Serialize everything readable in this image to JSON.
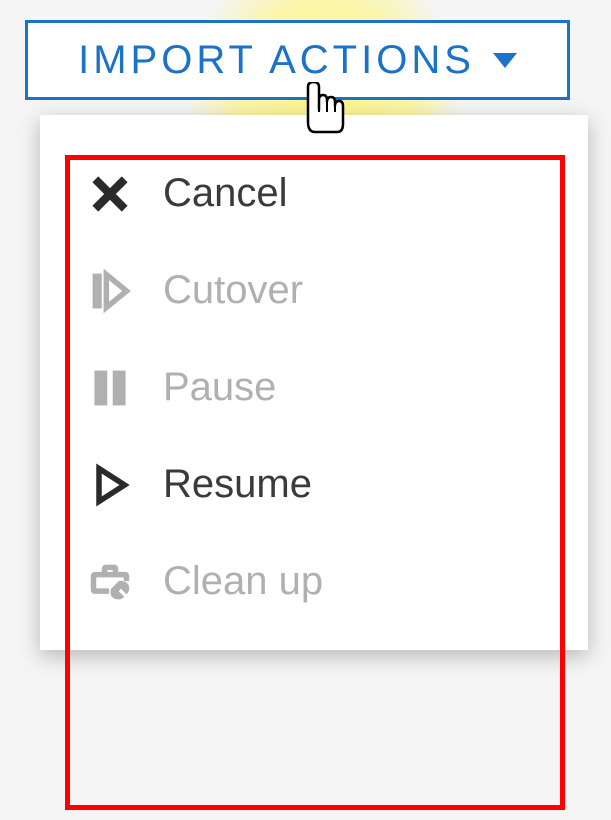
{
  "button": {
    "label": "IMPORT ACTIONS"
  },
  "menu": {
    "items": [
      {
        "label": "Cancel",
        "enabled": true,
        "icon": "close"
      },
      {
        "label": "Cutover",
        "enabled": false,
        "icon": "cutover"
      },
      {
        "label": "Pause",
        "enabled": false,
        "icon": "pause"
      },
      {
        "label": "Resume",
        "enabled": true,
        "icon": "play"
      },
      {
        "label": "Clean up",
        "enabled": false,
        "icon": "toolbox"
      }
    ]
  },
  "colors": {
    "accent": "#1b73c7",
    "highlight": "#fff578",
    "annotation": "#ff0000",
    "disabled": "#b0b0b0",
    "text": "#3a3a3a"
  }
}
